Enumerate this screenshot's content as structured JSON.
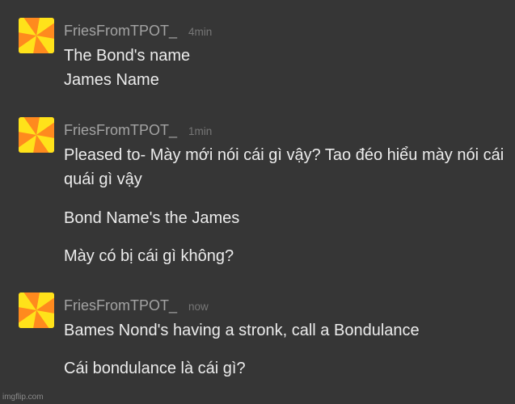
{
  "colors": {
    "background": "#363636",
    "username": "#a3a3a3",
    "timestamp": "#777777",
    "message_text": "#ececec",
    "avatar_orange": "#ff8a1e",
    "avatar_yellow": "#ffe21a"
  },
  "groups": [
    {
      "username": "FriesFromTPOT_",
      "timestamp": "4min",
      "avatar_icon": "pinwheel-icon",
      "messages": [
        "The Bond's name\nJames Name"
      ]
    },
    {
      "username": "FriesFromTPOT_",
      "timestamp": "1min",
      "avatar_icon": "pinwheel-icon",
      "messages": [
        "Pleased to- Mày mới nói cái gì vậy? Tao đéo hiểu mày nói cái quái gì vậy",
        "Bond Name's the James",
        "Mày có bị cái gì không?"
      ]
    },
    {
      "username": "FriesFromTPOT_",
      "timestamp": "now",
      "avatar_icon": "pinwheel-icon",
      "messages": [
        "Bames Nond's having a stronk, call a Bondulance",
        "Cái bondulance là cái gì?"
      ]
    }
  ],
  "watermark": "imgflip.com"
}
